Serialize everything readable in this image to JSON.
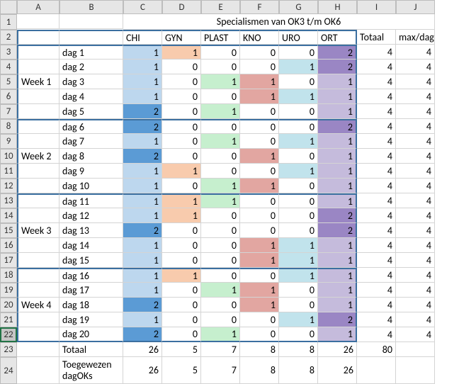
{
  "cols": [
    "",
    "A",
    "B",
    "C",
    "D",
    "E",
    "F",
    "G",
    "H",
    "I",
    "J"
  ],
  "title": "Specialismen van OK3 t/m OK6",
  "headers": {
    "C": "CHI",
    "D": "GYN",
    "E": "PLAST",
    "F": "KNO",
    "G": "URO",
    "H": "ORT",
    "I": "Totaal",
    "J": "max/dag"
  },
  "weeks": [
    "Week 1",
    "Week 2",
    "Week 3",
    "Week 4"
  ],
  "rows": [
    {
      "r": 3,
      "day": "dag 1",
      "v": [
        1,
        1,
        0,
        0,
        0,
        2,
        4,
        4
      ]
    },
    {
      "r": 4,
      "day": "dag 2",
      "v": [
        1,
        0,
        0,
        0,
        1,
        2,
        4,
        4
      ]
    },
    {
      "r": 5,
      "day": "dag 3",
      "v": [
        1,
        0,
        1,
        1,
        0,
        1,
        4,
        4
      ]
    },
    {
      "r": 6,
      "day": "dag 4",
      "v": [
        1,
        0,
        0,
        1,
        1,
        1,
        4,
        4
      ]
    },
    {
      "r": 7,
      "day": "dag 5",
      "v": [
        2,
        0,
        1,
        0,
        0,
        1,
        4,
        4
      ]
    },
    {
      "r": 8,
      "day": "dag 6",
      "v": [
        2,
        0,
        0,
        0,
        0,
        2,
        4,
        4
      ]
    },
    {
      "r": 9,
      "day": "dag 7",
      "v": [
        1,
        0,
        1,
        0,
        1,
        1,
        4,
        4
      ]
    },
    {
      "r": 10,
      "day": "dag 8",
      "v": [
        2,
        0,
        0,
        1,
        0,
        1,
        4,
        4
      ]
    },
    {
      "r": 11,
      "day": "dag 9",
      "v": [
        1,
        1,
        0,
        0,
        1,
        1,
        4,
        4
      ]
    },
    {
      "r": 12,
      "day": "dag 10",
      "v": [
        1,
        0,
        1,
        1,
        0,
        1,
        4,
        4
      ]
    },
    {
      "r": 13,
      "day": "dag 11",
      "v": [
        1,
        1,
        1,
        0,
        0,
        1,
        4,
        4
      ]
    },
    {
      "r": 14,
      "day": "dag 12",
      "v": [
        1,
        1,
        0,
        0,
        0,
        2,
        4,
        4
      ]
    },
    {
      "r": 15,
      "day": "dag 13",
      "v": [
        2,
        0,
        0,
        0,
        0,
        2,
        4,
        4
      ]
    },
    {
      "r": 16,
      "day": "dag 14",
      "v": [
        1,
        0,
        0,
        1,
        1,
        1,
        4,
        4
      ]
    },
    {
      "r": 17,
      "day": "dag 15",
      "v": [
        1,
        0,
        0,
        1,
        1,
        1,
        4,
        4
      ]
    },
    {
      "r": 18,
      "day": "dag 16",
      "v": [
        1,
        1,
        0,
        0,
        1,
        1,
        4,
        4
      ]
    },
    {
      "r": 19,
      "day": "dag 17",
      "v": [
        1,
        0,
        1,
        1,
        0,
        1,
        4,
        4
      ]
    },
    {
      "r": 20,
      "day": "dag 18",
      "v": [
        2,
        0,
        0,
        1,
        0,
        1,
        4,
        4
      ]
    },
    {
      "r": 21,
      "day": "dag 19",
      "v": [
        1,
        0,
        0,
        0,
        1,
        2,
        4,
        4
      ]
    },
    {
      "r": 22,
      "day": "dag 20",
      "v": [
        2,
        0,
        1,
        0,
        0,
        1,
        4,
        4
      ]
    }
  ],
  "totals": {
    "label": "Totaal",
    "v": [
      26,
      5,
      7,
      8,
      8,
      26,
      80,
      ""
    ]
  },
  "assigned": {
    "label": "Toegewezen dagOKs",
    "v": [
      26,
      5,
      7,
      8,
      8,
      26,
      "",
      ""
    ]
  },
  "chart_data": {
    "type": "table",
    "title": "Specialismen van OK3 t/m OK6",
    "columns": [
      "CHI",
      "GYN",
      "PLAST",
      "KNO",
      "URO",
      "ORT",
      "Totaal",
      "max/dag"
    ],
    "row_labels": [
      "dag 1",
      "dag 2",
      "dag 3",
      "dag 4",
      "dag 5",
      "dag 6",
      "dag 7",
      "dag 8",
      "dag 9",
      "dag 10",
      "dag 11",
      "dag 12",
      "dag 13",
      "dag 14",
      "dag 15",
      "dag 16",
      "dag 17",
      "dag 18",
      "dag 19",
      "dag 20",
      "Totaal",
      "Toegewezen dagOKs"
    ],
    "data": [
      [
        1,
        1,
        0,
        0,
        0,
        2,
        4,
        4
      ],
      [
        1,
        0,
        0,
        0,
        1,
        2,
        4,
        4
      ],
      [
        1,
        0,
        1,
        1,
        0,
        1,
        4,
        4
      ],
      [
        1,
        0,
        0,
        1,
        1,
        1,
        4,
        4
      ],
      [
        2,
        0,
        1,
        0,
        0,
        1,
        4,
        4
      ],
      [
        2,
        0,
        0,
        0,
        0,
        2,
        4,
        4
      ],
      [
        1,
        0,
        1,
        0,
        1,
        1,
        4,
        4
      ],
      [
        2,
        0,
        0,
        1,
        0,
        1,
        4,
        4
      ],
      [
        1,
        1,
        0,
        0,
        1,
        1,
        4,
        4
      ],
      [
        1,
        0,
        1,
        1,
        0,
        1,
        4,
        4
      ],
      [
        1,
        1,
        1,
        0,
        0,
        1,
        4,
        4
      ],
      [
        1,
        1,
        0,
        0,
        0,
        2,
        4,
        4
      ],
      [
        2,
        0,
        0,
        0,
        0,
        2,
        4,
        4
      ],
      [
        1,
        0,
        0,
        1,
        1,
        1,
        4,
        4
      ],
      [
        1,
        0,
        0,
        1,
        1,
        1,
        4,
        4
      ],
      [
        1,
        1,
        0,
        0,
        1,
        1,
        4,
        4
      ],
      [
        1,
        0,
        1,
        1,
        0,
        1,
        4,
        4
      ],
      [
        2,
        0,
        0,
        1,
        0,
        1,
        4,
        4
      ],
      [
        1,
        0,
        0,
        0,
        1,
        2,
        4,
        4
      ],
      [
        2,
        0,
        1,
        0,
        0,
        1,
        4,
        4
      ],
      [
        26,
        5,
        7,
        8,
        8,
        26,
        80,
        null
      ],
      [
        26,
        5,
        7,
        8,
        8,
        26,
        null,
        null
      ]
    ]
  }
}
